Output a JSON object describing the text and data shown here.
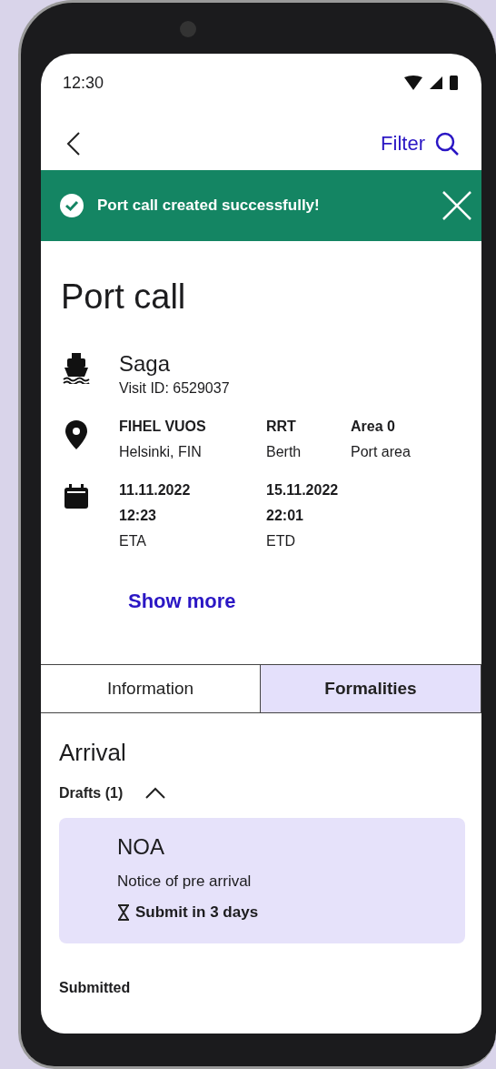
{
  "status_bar": {
    "time": "12:30"
  },
  "nav": {
    "filter_label": "Filter"
  },
  "banner": {
    "message": "Port call created successfully!"
  },
  "title": "Port call",
  "ship": {
    "name": "Saga",
    "visit_id": "Visit ID: 6529037"
  },
  "location": [
    {
      "primary": "FIHEL VUOS",
      "secondary": "Helsinki, FIN"
    },
    {
      "primary": "RRT",
      "secondary": "Berth"
    },
    {
      "primary": "Area 0",
      "secondary": "Port area"
    }
  ],
  "dates": [
    {
      "date": "11.11.2022",
      "time": "12:23",
      "label": "ETA"
    },
    {
      "date": "15.11.2022",
      "time": "22:01",
      "label": "ETD"
    }
  ],
  "show_more": "Show more",
  "tabs": [
    {
      "label": "Information",
      "selected": false
    },
    {
      "label": "Formalities",
      "selected": true
    }
  ],
  "section": {
    "title": "Arrival",
    "drafts": {
      "label": "Drafts (1)",
      "expanded": true,
      "items": [
        {
          "code": "NOA",
          "title": "Notice of pre arrival",
          "due": "Submit in 3 days"
        }
      ]
    },
    "submitted": {
      "label": "Submitted"
    }
  }
}
